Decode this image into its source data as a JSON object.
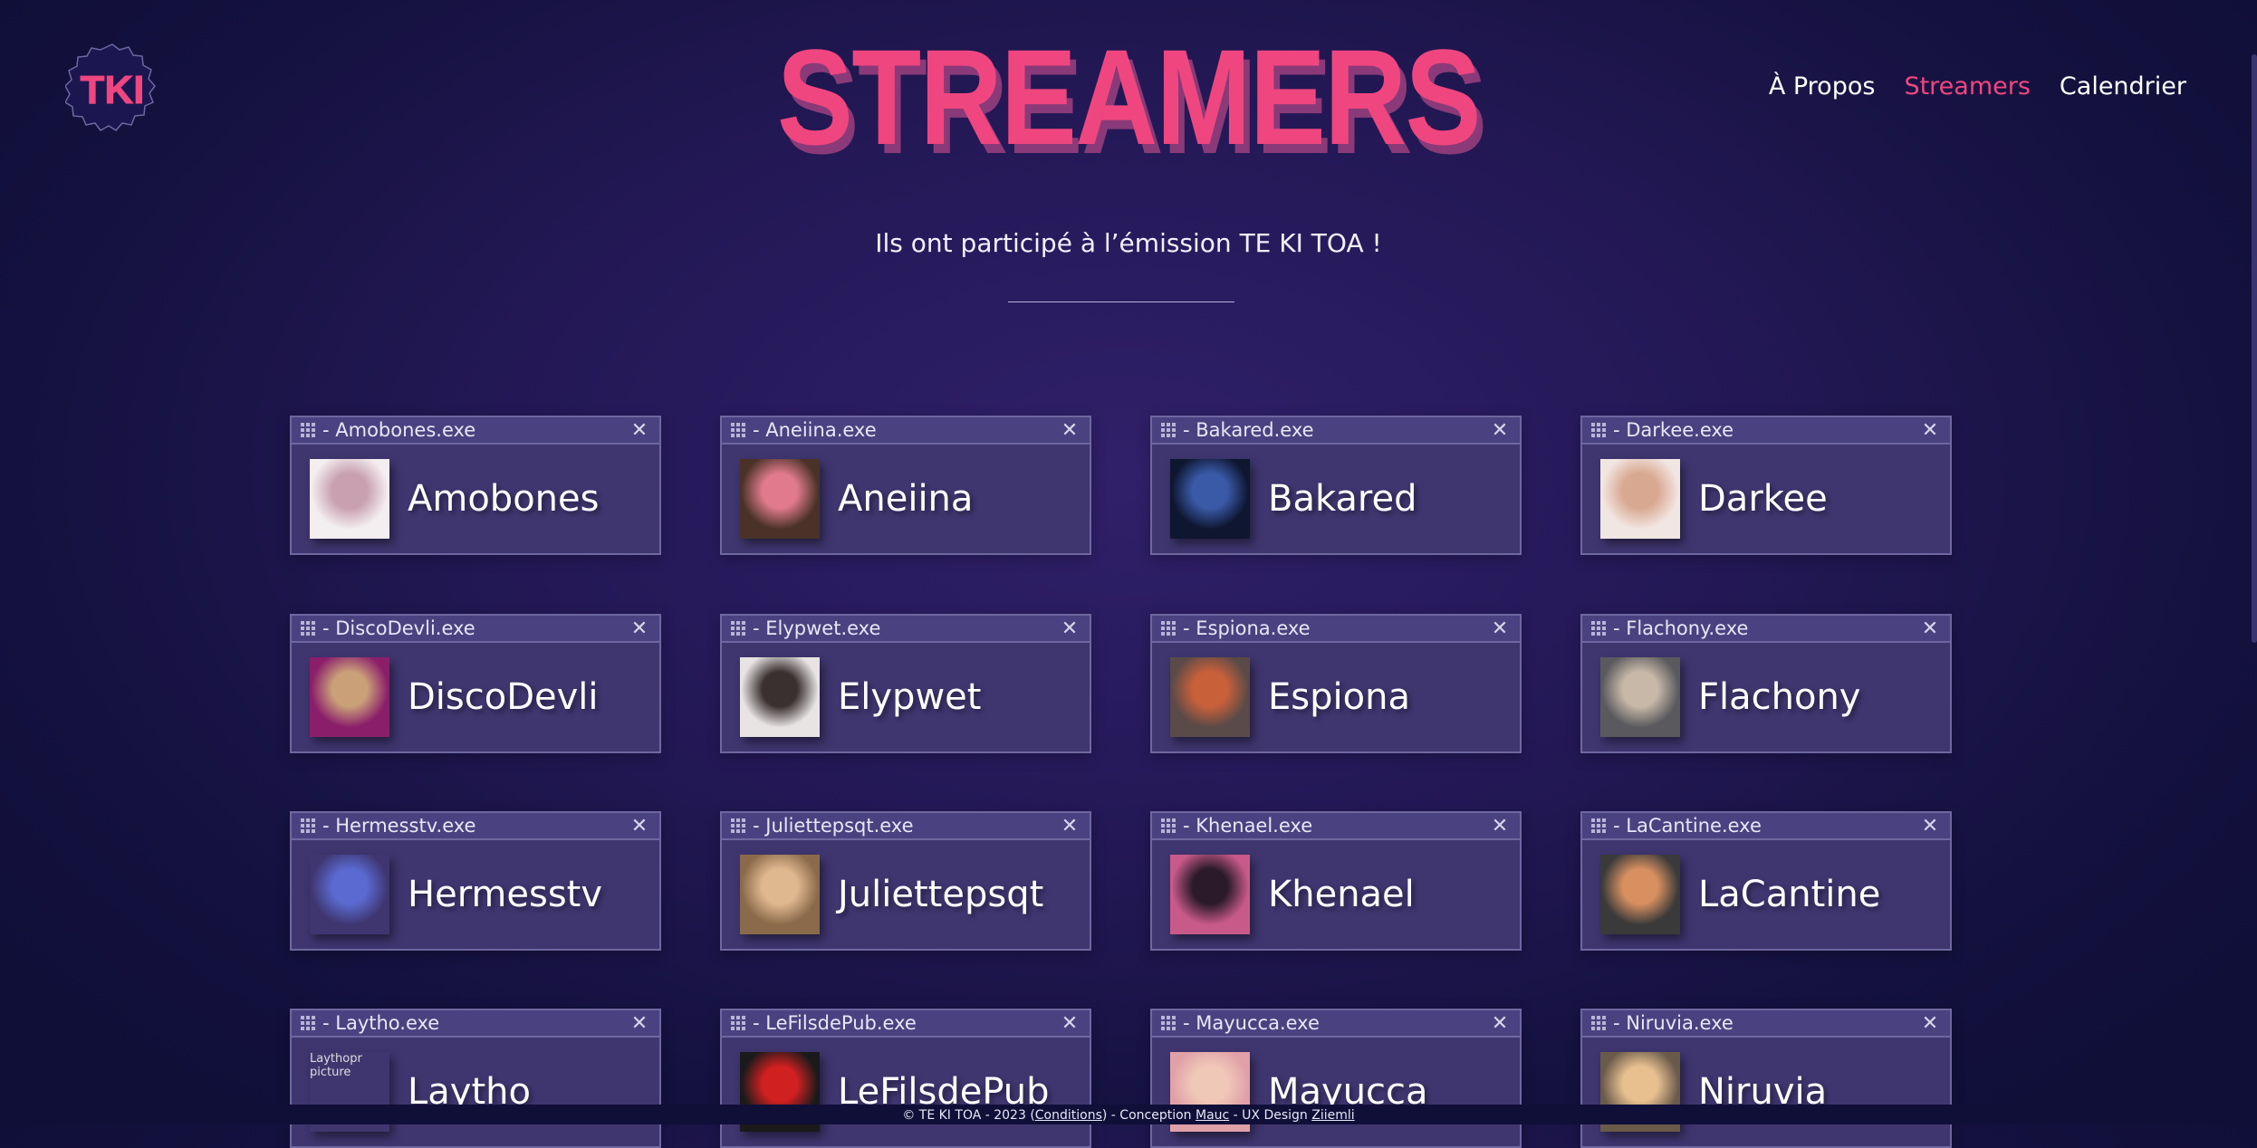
{
  "logo_text": "TKI",
  "page_title": "STREAMERS",
  "nav": [
    {
      "label": "À Propos",
      "active": false
    },
    {
      "label": "Streamers",
      "active": true
    },
    {
      "label": "Calendrier",
      "active": false
    }
  ],
  "subtitle": "Ils ont participé à l’émission TE KI TOA !",
  "colors": {
    "accent": "#f0467f",
    "background": "#1d1650",
    "card": "#3f3670"
  },
  "streamers": [
    {
      "window_title": "- Amobones.exe",
      "name": "Amobones",
      "avatar_bg": "#f3eef0",
      "avatar_fg": "#c8a0b0"
    },
    {
      "window_title": "- Aneiina.exe",
      "name": "Aneiina",
      "avatar_bg": "#4a3228",
      "avatar_fg": "#e07a8c"
    },
    {
      "window_title": "- Bakared.exe",
      "name": "Bakared",
      "avatar_bg": "#0e1630",
      "avatar_fg": "#3a5aa8"
    },
    {
      "window_title": "- Darkee.exe",
      "name": "Darkee",
      "avatar_bg": "#f2e6e2",
      "avatar_fg": "#d8a890"
    },
    {
      "window_title": "- DiscoDevli.exe",
      "name": "DiscoDevli",
      "avatar_bg": "#8a1e6a",
      "avatar_fg": "#c9a078"
    },
    {
      "window_title": "- Elypwet.exe",
      "name": "Elypwet",
      "avatar_bg": "#e8e4e4",
      "avatar_fg": "#3a3030"
    },
    {
      "window_title": "- Espiona.exe",
      "name": "Espiona",
      "avatar_bg": "#5a4a48",
      "avatar_fg": "#c8603a"
    },
    {
      "window_title": "- Flachony.exe",
      "name": "Flachony",
      "avatar_bg": "#5a5a5e",
      "avatar_fg": "#c8b8a8"
    },
    {
      "window_title": "- Hermesstv.exe",
      "name": "Hermesstv",
      "avatar_bg": "#3f3670",
      "avatar_fg": "#5a6ad0"
    },
    {
      "window_title": "- Juliettepsqt.exe",
      "name": "Juliettepsqt",
      "avatar_bg": "#8a6a4a",
      "avatar_fg": "#e0b890"
    },
    {
      "window_title": "- Khenael.exe",
      "name": "Khenael",
      "avatar_bg": "#c85a8a",
      "avatar_fg": "#2a1a2a"
    },
    {
      "window_title": "- LaCantine.exe",
      "name": "LaCantine",
      "avatar_bg": "#3a3a3a",
      "avatar_fg": "#d89060"
    },
    {
      "window_title": "- Laytho.exe",
      "name": "Laytho",
      "avatar_bg": "#3f3670",
      "avatar_fg": "#3f3670",
      "avatar_alt": "Laythopr picture"
    },
    {
      "window_title": "- LeFilsdePub.exe",
      "name": "LeFilsdePub",
      "avatar_bg": "#1a1a1a",
      "avatar_fg": "#d02020"
    },
    {
      "window_title": "- Mayucca.exe",
      "name": "Mayucca",
      "avatar_bg": "#e0a0a8",
      "avatar_fg": "#f0c8b8"
    },
    {
      "window_title": "- Niruvia.exe",
      "name": "Niruvia",
      "avatar_bg": "#6a5a4a",
      "avatar_fg": "#e8c090"
    }
  ],
  "footer": {
    "prefix": "© TE KI TOA - 2023 (",
    "conditions": "Conditions",
    "middle": ") - Conception ",
    "designer": "Mauc",
    "ux_prefix": " - UX Design ",
    "ux_designer": "Ziiemli"
  }
}
